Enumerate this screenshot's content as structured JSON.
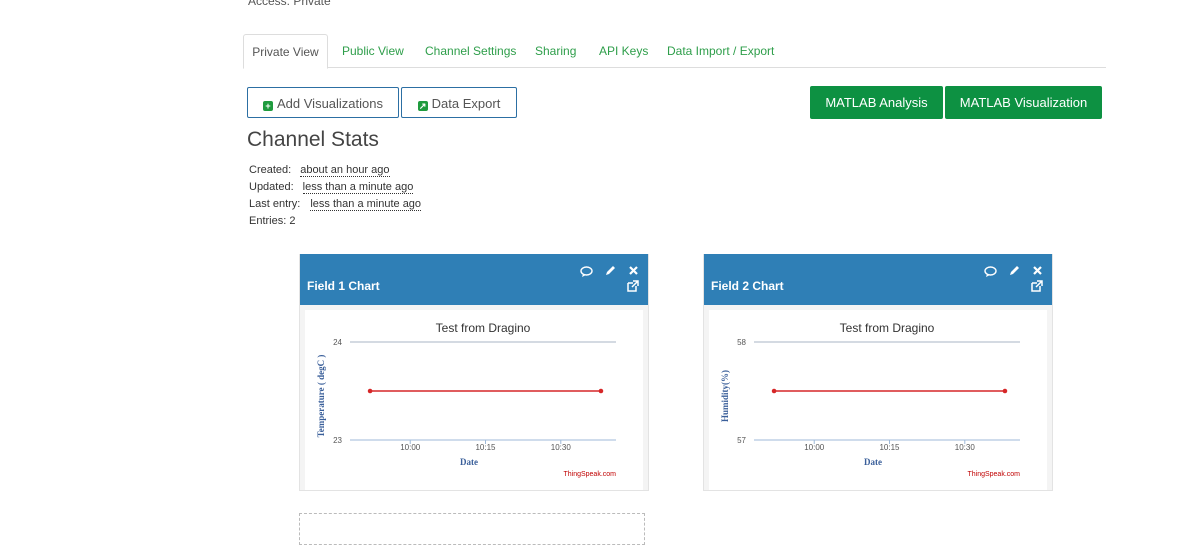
{
  "access_text": "Access: Private",
  "tabs": [
    {
      "label": "Private View"
    },
    {
      "label": "Public View"
    },
    {
      "label": "Channel Settings"
    },
    {
      "label": "Sharing"
    },
    {
      "label": "API Keys"
    },
    {
      "label": "Data Import / Export"
    }
  ],
  "buttons": {
    "add_visualizations": "Add Visualizations",
    "data_export": "Data Export",
    "matlab_analysis": "MATLAB Analysis",
    "matlab_visualization": "MATLAB Visualization"
  },
  "stats": {
    "title": "Channel Stats",
    "created_label": "Created:",
    "created_value": "about an hour ago",
    "updated_label": "Updated:",
    "updated_value": "less than a minute ago",
    "last_entry_label": "Last entry:",
    "last_entry_value": "less than a minute ago",
    "entries": "Entries: 2"
  },
  "panels": [
    {
      "title": "Field 1 Chart"
    },
    {
      "title": "Field 2 Chart"
    }
  ],
  "colors": {
    "panel_header": "#2f7fb6",
    "green": "#0d9142",
    "tab_link": "#2e9e4a",
    "series": "#d62728",
    "axis_label": "#3a5f9a",
    "watermark": "#c00000"
  },
  "chart_data": [
    {
      "type": "line",
      "title": "Test from Dragino",
      "xlabel": "Date",
      "ylabel": "Temperature ( degC )",
      "x_ticks": [
        "10:00",
        "10:15",
        "10:30"
      ],
      "y_ticks": [
        "24",
        "23"
      ],
      "ylim": [
        23,
        24
      ],
      "series": [
        {
          "x": [
            "09:52",
            "10:38"
          ],
          "values": [
            23.5,
            23.5
          ]
        }
      ],
      "credit": "ThingSpeak.com"
    },
    {
      "type": "line",
      "title": "Test from Dragino",
      "xlabel": "Date",
      "ylabel": "Humidity(%)",
      "x_ticks": [
        "10:00",
        "10:15",
        "10:30"
      ],
      "y_ticks": [
        "58",
        "57"
      ],
      "ylim": [
        57,
        58
      ],
      "series": [
        {
          "x": [
            "09:52",
            "10:38"
          ],
          "values": [
            57.5,
            57.5
          ]
        }
      ],
      "credit": "ThingSpeak.com"
    }
  ]
}
